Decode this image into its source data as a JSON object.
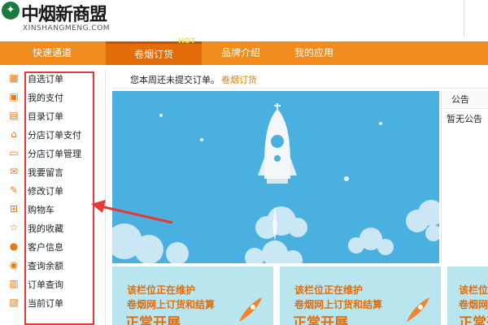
{
  "header": {
    "logo_text": "中烟新商盟",
    "logo_sub": "XINSHANGMENG.COM"
  },
  "nav": {
    "quick": "快速通道",
    "active": "卷烟订货",
    "hot": "HOT",
    "brand": "品牌介绍",
    "apps": "我的应用"
  },
  "sidebar": {
    "items": [
      {
        "label": "自选订单",
        "icon": "grid-icon"
      },
      {
        "label": "我的支付",
        "icon": "wallet-icon"
      },
      {
        "label": "目录订单",
        "icon": "catalog-icon"
      },
      {
        "label": "分店订单支付",
        "icon": "store-icon"
      },
      {
        "label": "分店订单管理",
        "icon": "monitor-icon"
      },
      {
        "label": "我要留言",
        "icon": "mail-icon"
      },
      {
        "label": "修改订单",
        "icon": "edit-icon"
      },
      {
        "label": "购物车",
        "icon": "cart-icon"
      },
      {
        "label": "我的收藏",
        "icon": "star-icon"
      },
      {
        "label": "客户信息",
        "icon": "user-icon"
      },
      {
        "label": "查询余额",
        "icon": "coin-icon"
      },
      {
        "label": "订单查询",
        "icon": "search-doc-icon"
      },
      {
        "label": "当前订单",
        "icon": "current-order-icon"
      }
    ]
  },
  "notice": {
    "text": "您本周还未提交订单。",
    "link": "卷烟订货"
  },
  "announce": {
    "title": "公告",
    "empty": "暂无公告"
  },
  "promo": {
    "line1": "该栏位正在维护",
    "line2": "卷烟网上订货和结算",
    "line3": "正常开展"
  },
  "colors": {
    "accent": "#f08b1d",
    "banner": "#4ab0e0",
    "promo_bg": "#b9e6ee",
    "highlight_frame": "#e53935"
  }
}
